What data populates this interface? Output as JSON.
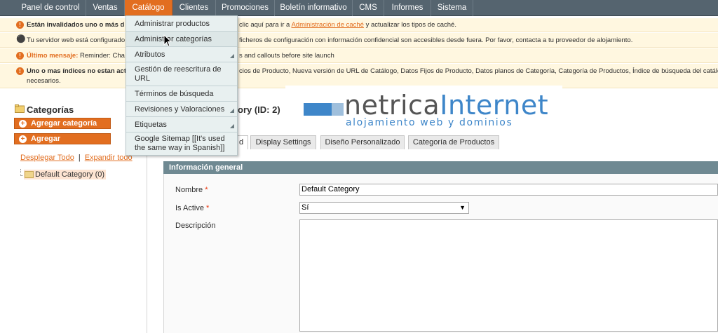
{
  "nav": {
    "tabs": [
      {
        "label": "Panel de control"
      },
      {
        "label": "Ventas"
      },
      {
        "label": "Catálogo"
      },
      {
        "label": "Clientes"
      },
      {
        "label": "Promociones"
      },
      {
        "label": "Boletín informativo"
      },
      {
        "label": "CMS"
      },
      {
        "label": "Informes"
      },
      {
        "label": "Sistema"
      }
    ],
    "active_index": 2
  },
  "notices": [
    {
      "type": "error",
      "bold": "Están invalidados uno o más d",
      "text": "clic aquí para ir a ",
      "link": "Administración de caché",
      "tail": " y actualizar los tipos de caché."
    },
    {
      "type": "info",
      "text_a": "Tu servidor web está configurado",
      "text_b": "ficheros de configuración con información confidencial son accesibles desde fuera. Por favor, contacta a tu proveedor de alojamiento."
    },
    {
      "type": "error",
      "label": "Último mensaje:",
      "text_a": " Reminder: Cha",
      "text_b": "s and callouts before site launch"
    },
    {
      "type": "error",
      "bold": "Uno o mas índices no estan act",
      "text_b": "cios de Producto, Nueva versión de URL de Catálogo, Datos Fijos de Producto, Datos planos de Categoría, Categoría de Productos, Índice de búsqueda del catálo",
      "line2": "necesarios."
    }
  ],
  "catalog_menu": {
    "items": [
      {
        "label": "Administrar productos",
        "has_submenu": false
      },
      {
        "label": "Administrar categorías",
        "has_submenu": false
      },
      {
        "label": "Atributos",
        "has_submenu": true
      },
      {
        "label": "Gestión de reescritura de URL",
        "has_submenu": false
      },
      {
        "label": "Términos de búsqueda",
        "has_submenu": false
      },
      {
        "label": "Revisiones y Valoraciones",
        "has_submenu": true
      },
      {
        "label": "Etiquetas",
        "has_submenu": true
      },
      {
        "label": "Google Sitemap [[It's used the same way in Spanish]]",
        "has_submenu": false
      }
    ]
  },
  "left": {
    "title": "Categorías",
    "add_root_label": "Agregar categoría raíz",
    "add_sub_label": "Agregar subcategoría",
    "collapse_all": "Desplegar Todo",
    "separator": "|",
    "expand_all": "Expandir todo",
    "tree_node": "Default Category (0)"
  },
  "main": {
    "title_fragment": "ory (ID: 2)",
    "tabs": [
      "d",
      "Display Settings",
      "Diseño Personalizado",
      "Categoría de Productos"
    ],
    "section_title": "Información general",
    "fields": {
      "name_label": "Nombre",
      "name_value": "Default Category",
      "active_label": "Is Active",
      "active_value": "Sí",
      "description_label": "Descripción",
      "required_mark": "*"
    }
  },
  "logo": {
    "name_a": "netrica",
    "name_b": "Internet",
    "tagline": "alojamiento web y dominios"
  },
  "colors": {
    "accent": "#e26e20",
    "nav_bg": "#55646f",
    "section_head": "#6f8992",
    "logo_blue": "#3e86c9"
  }
}
